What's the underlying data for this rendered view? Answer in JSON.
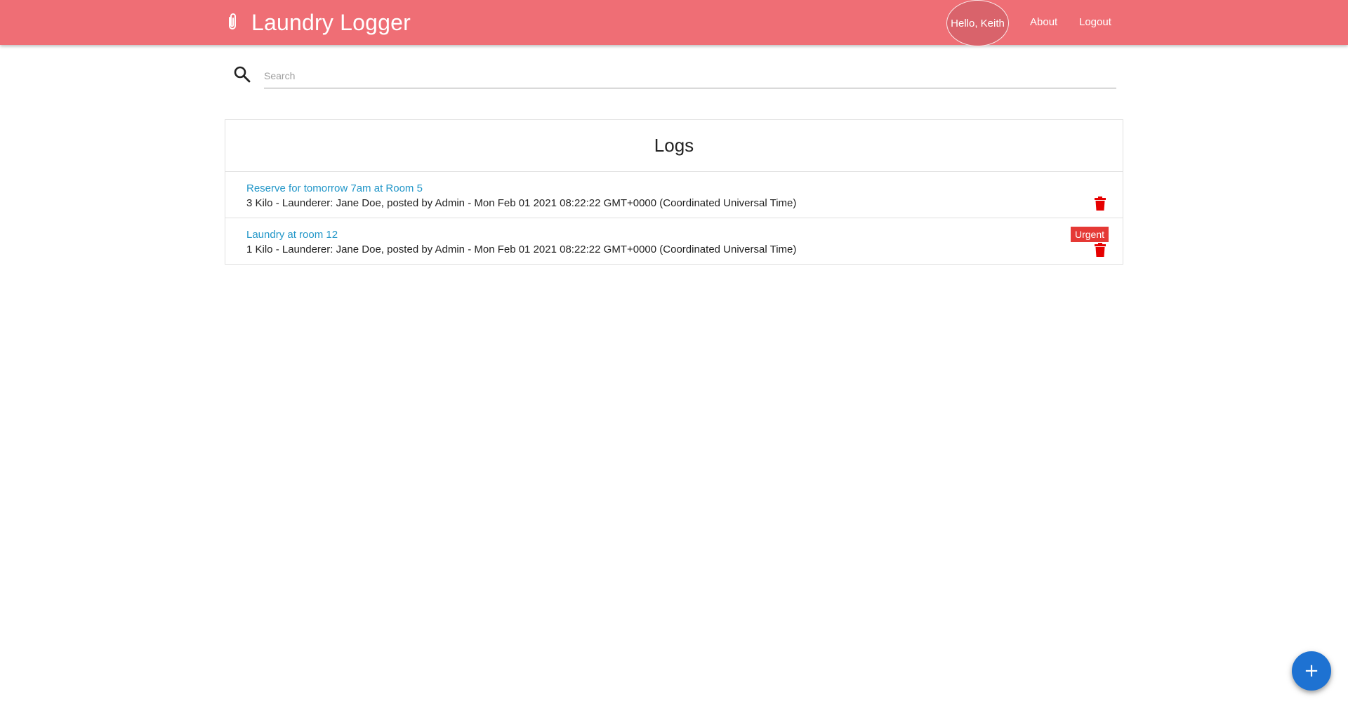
{
  "navbar": {
    "brand_icon": "paperclip-icon",
    "brand_title": "Laundry Logger",
    "greeting": "Hello, Keith",
    "links": [
      {
        "label": "About"
      },
      {
        "label": "Logout"
      }
    ],
    "background_color": "#ef6e75"
  },
  "search": {
    "icon": "search-icon",
    "placeholder": "Search",
    "value": ""
  },
  "logs": {
    "heading": "Logs",
    "items": [
      {
        "title": "Reserve for tomorrow 7am at Room 5",
        "details": "3 Kilo - Launderer: Jane Doe, posted by Admin - Mon Feb 01 2021 08:22:22 GMT+0000 (Coordinated Universal Time)",
        "badge": "",
        "delete_icon": "trash-icon"
      },
      {
        "title": "Laundry at room 12",
        "details": "1 Kilo - Launderer: Jane Doe, posted by Admin - Mon Feb 01 2021 08:22:22 GMT+0000 (Coordinated Universal Time)",
        "badge": "Urgent",
        "delete_icon": "trash-icon"
      }
    ],
    "title_color": "#2196c8",
    "badge_color": "#e53935",
    "delete_color": "#e60000"
  },
  "fab": {
    "icon": "plus-icon",
    "symbol": "+",
    "color": "#1e72d2"
  }
}
